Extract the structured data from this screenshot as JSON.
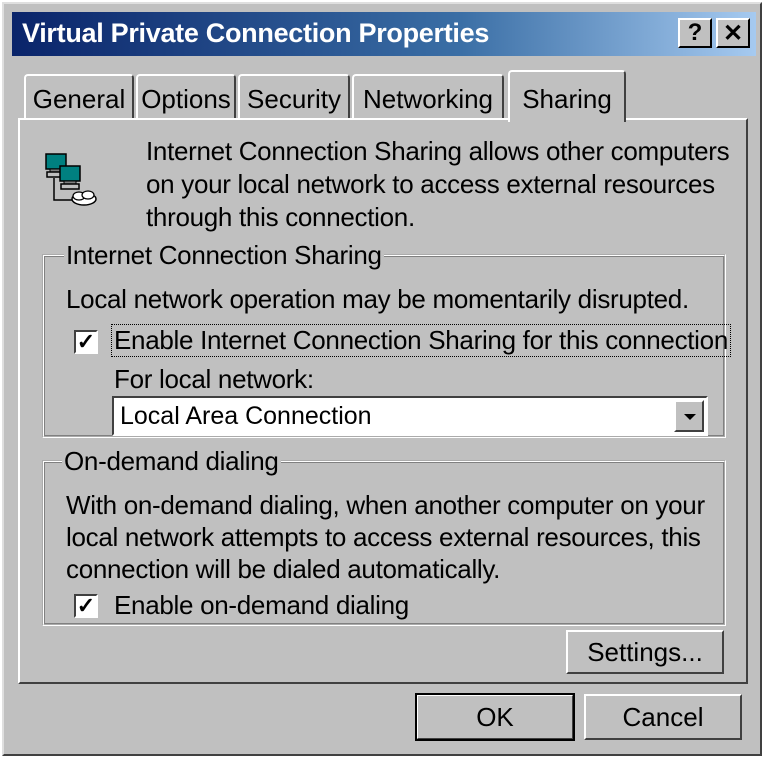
{
  "window": {
    "title": "Virtual Private Connection Properties"
  },
  "titlebar": {
    "help_label": "?",
    "close_label": "✕"
  },
  "tabs": [
    "General",
    "Options",
    "Security",
    "Networking",
    "Sharing"
  ],
  "active_tab": "Sharing",
  "intro": {
    "icon": "network-connection-icon",
    "lines": [
      "Internet Connection Sharing allows other computers",
      "on your local network to access external resources",
      "through this connection."
    ]
  },
  "ics_group": {
    "legend": "Internet Connection Sharing",
    "note": "Local network operation may be momentarily disrupted.",
    "enable_checkbox": {
      "checked": true,
      "label": "Enable Internet Connection Sharing for this connection"
    },
    "local_network_label": "For local network:",
    "local_network_value": "Local Area Connection"
  },
  "ondemand_group": {
    "legend": "On-demand dialing",
    "lines": [
      "With on-demand dialing, when another computer on your",
      "local network attempts to access external resources, this",
      "connection will be dialed automatically."
    ],
    "enable_checkbox": {
      "checked": true,
      "label": "Enable on-demand dialing"
    }
  },
  "buttons": {
    "settings": "Settings...",
    "ok": "OK",
    "cancel": "Cancel"
  },
  "check_mark": "✓"
}
